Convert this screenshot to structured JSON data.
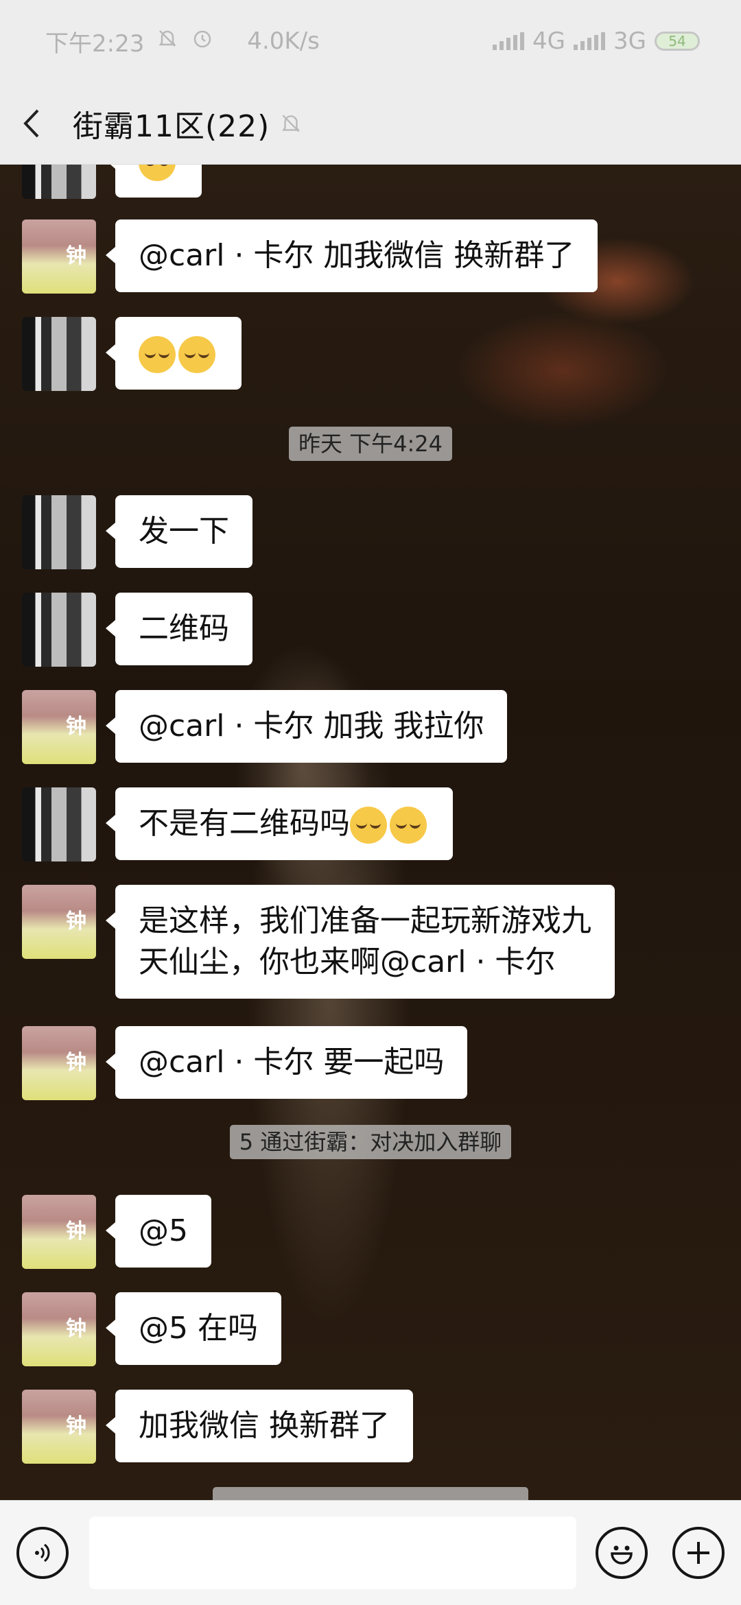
{
  "status_bar": {
    "time": "下午2:23",
    "speed": "4.0K/s",
    "network1": "4G",
    "network2": "3G",
    "battery": "54"
  },
  "header": {
    "title": "街霸11区(22)"
  },
  "messages": [
    {
      "avatar": "man",
      "text": ""
    },
    {
      "avatar": "girl",
      "text": "@carl · 卡尔 加我微信 换新群了"
    },
    {
      "avatar": "man",
      "text": ""
    },
    {
      "avatar": "man",
      "text": "发一下"
    },
    {
      "avatar": "man",
      "text": "二维码"
    },
    {
      "avatar": "girl",
      "text": "@carl · 卡尔 加我 我拉你"
    },
    {
      "avatar": "man",
      "text": "不是有二维码吗"
    },
    {
      "avatar": "girl",
      "text": "是这样，我们准备一起玩新游戏九\n天仙尘，你也来啊@carl · 卡尔"
    },
    {
      "avatar": "girl",
      "text": "@carl · 卡尔 要一起吗"
    },
    {
      "avatar": "girl",
      "text": "@5"
    },
    {
      "avatar": "girl",
      "text": "@5 在吗"
    },
    {
      "avatar": "girl",
      "text": "加我微信 换新群了"
    }
  ],
  "system": {
    "timestamp": "昨天 下午4:24",
    "join_notice": "5 通过街霸：对决加入群聊"
  },
  "avatar_char": "钟",
  "input": {
    "placeholder": ""
  }
}
